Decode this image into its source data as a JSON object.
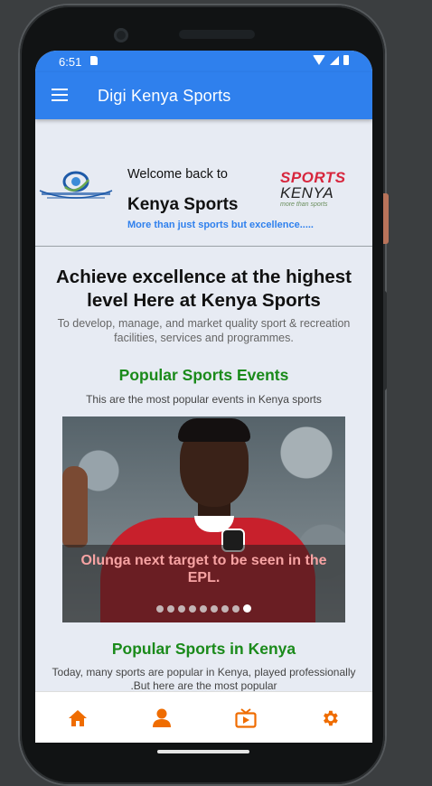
{
  "status_bar": {
    "time": "6:51"
  },
  "app_bar": {
    "title": "Digi Kenya Sports"
  },
  "welcome": {
    "greeting": "Welcome back to",
    "brand_name": "Kenya Sports",
    "tagline": "More than just sports but excellence.....",
    "logo_text_line1": "SPORTS",
    "logo_text_line2": "KENYA",
    "logo_text_line3": "more than sports"
  },
  "hero": {
    "headline": "Achieve excellence at the highest level Here at Kenya Sports",
    "subline": "To develop, manage, and market quality sport & recreation facilities, services and programmes."
  },
  "events": {
    "title": "Popular Sports Events",
    "description": "This are the most popular events in Kenya sports",
    "carousel": {
      "caption": "Olunga next target to be seen in the EPL.",
      "slide_count": 9,
      "active_index": 8
    }
  },
  "popular": {
    "title": "Popular Sports in Kenya",
    "description": "Today, many sports are popular in Kenya, played professionally .But here are the most popular"
  },
  "bottom_nav": {
    "items": [
      {
        "name": "home-icon"
      },
      {
        "name": "person-icon"
      },
      {
        "name": "tv-icon"
      },
      {
        "name": "gear-icon"
      }
    ],
    "accent_color": "#ef6c00"
  },
  "colors": {
    "primary": "#2f80ed",
    "section_title": "#1a8a1a",
    "background": "#e7ebf3"
  }
}
